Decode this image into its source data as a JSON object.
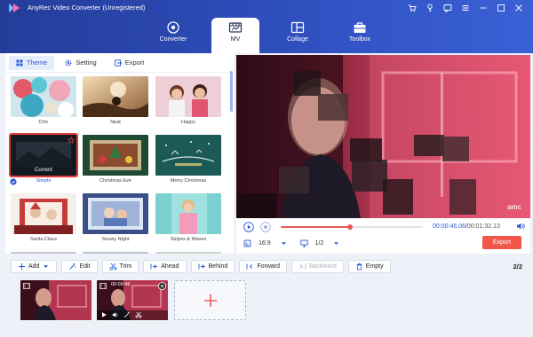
{
  "app": {
    "title": "AnyRec Video Converter (Unregistered)"
  },
  "window_controls": [
    "cart-icon",
    "key-icon",
    "feedback-icon",
    "menu-icon",
    "minimize-icon",
    "maximize-icon",
    "close-icon"
  ],
  "nav": {
    "tabs": [
      {
        "label": "Converter",
        "icon": "converter-icon"
      },
      {
        "label": "MV",
        "icon": "mv-icon",
        "active": true
      },
      {
        "label": "Collage",
        "icon": "collage-icon"
      },
      {
        "label": "Toolbox",
        "icon": "toolbox-icon"
      }
    ]
  },
  "subtabs": [
    {
      "label": "Theme",
      "active": true
    },
    {
      "label": "Setting"
    },
    {
      "label": "Export"
    }
  ],
  "themes": [
    {
      "name": "Chic"
    },
    {
      "name": "Neat"
    },
    {
      "name": "Happy"
    },
    {
      "name": "Simple",
      "selected": true,
      "badge": "Current"
    },
    {
      "name": "Christmas Eve"
    },
    {
      "name": "Merry Christmas"
    },
    {
      "name": "Santa Claus"
    },
    {
      "name": "Snowy Night"
    },
    {
      "name": "Stripes & Waves"
    }
  ],
  "player": {
    "watermark": "amc",
    "progress": 0.49,
    "current_time": "00:00:46.06",
    "duration": "/00:01:32.13",
    "aspect_ratio": "16:9",
    "page_select": "1/2",
    "export_label": "Export"
  },
  "toolbar": {
    "add": "Add",
    "edit": "Edit",
    "trim": "Trim",
    "ahead": "Ahead",
    "behind": "Behind",
    "forward": "Forward",
    "backward": "Backward",
    "empty": "Empty",
    "pager_current": "2",
    "pager_total": "2"
  },
  "timeline": {
    "clips": [
      {
        "timestamp": ""
      },
      {
        "timestamp": "00:00:46",
        "selected": true
      }
    ]
  },
  "colors": {
    "header": "#2f4fbf",
    "accent": "#2b5ad6",
    "export_button": "#f0574a",
    "selection": "#e43b3b"
  }
}
